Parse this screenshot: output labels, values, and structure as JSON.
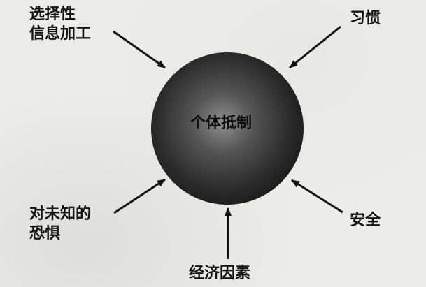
{
  "diagram": {
    "center": "个体抵制",
    "factors": {
      "selective_processing": [
        "选择性",
        "信息加工"
      ],
      "habit": "习惯",
      "fear_unknown": [
        "对未知的",
        "恐惧"
      ],
      "security": "安全",
      "economic": "经济因素"
    },
    "colors": {
      "sphere_highlight": "#8a8a8a",
      "sphere_shadow": "#0a0a0a",
      "arrow": "#141414",
      "background": "#ececea"
    }
  }
}
